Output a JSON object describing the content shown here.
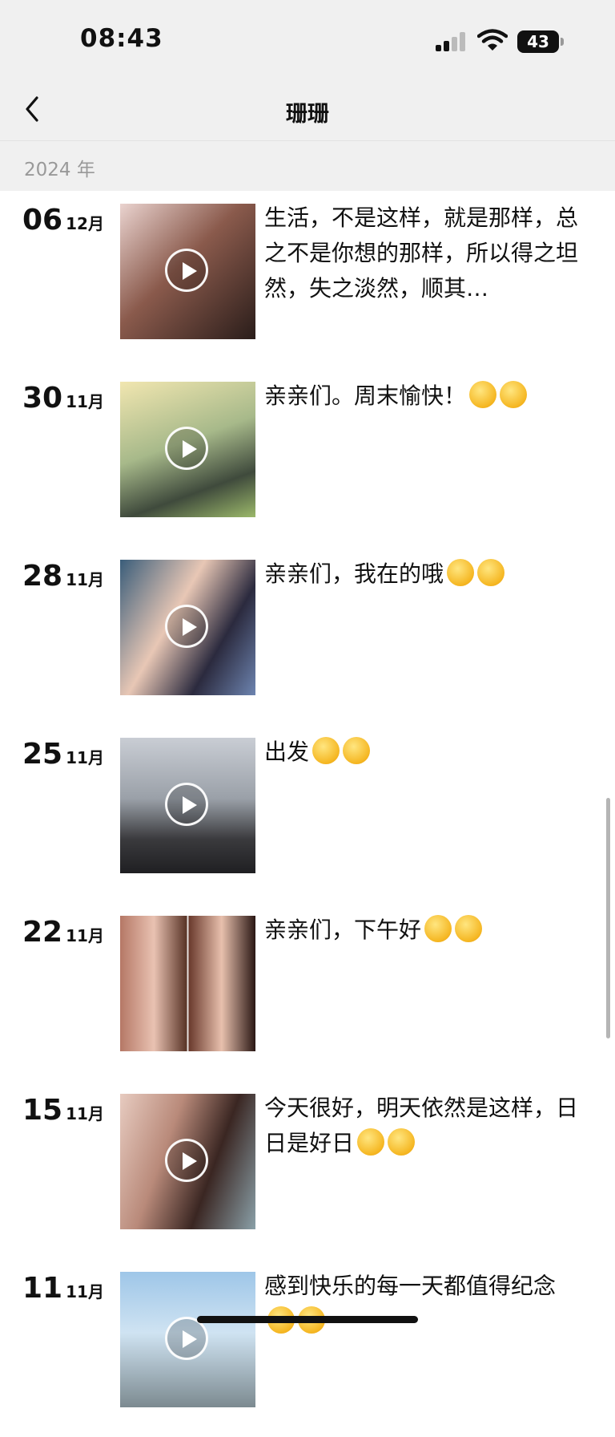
{
  "status_bar": {
    "time": "08:43",
    "battery": "43"
  },
  "nav": {
    "title": "珊珊"
  },
  "section": {
    "year": "2024 年"
  },
  "feed": {
    "items": [
      {
        "day": "06",
        "month": "12月",
        "caption": "生活，不是这样，就是那样，总之不是你想的那样，所以得之坦然，失之淡然，顺其…",
        "emoji_count": 0
      },
      {
        "day": "30",
        "month": "11月",
        "caption": "亲亲们。周末愉快！",
        "emoji_count": 2
      },
      {
        "day": "28",
        "month": "11月",
        "caption": "亲亲们，我在的哦",
        "emoji_count": 2
      },
      {
        "day": "25",
        "month": "11月",
        "caption": "出发",
        "emoji_count": 2
      },
      {
        "day": "22",
        "month": "11月",
        "caption": "亲亲们，下午好",
        "emoji_count": 2
      },
      {
        "day": "15",
        "month": "11月",
        "caption": "今天很好，明天依然是这样，日日是好日",
        "emoji_count": 2
      },
      {
        "day": "11",
        "month": "11月",
        "caption": "感到快乐的每一天都值得纪念",
        "emoji_count": 2
      }
    ]
  }
}
